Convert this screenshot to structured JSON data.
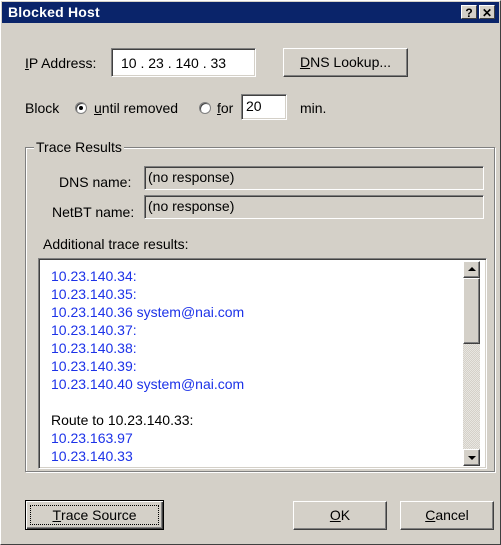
{
  "window": {
    "title": "Blocked Host",
    "help_button": "?",
    "close_button": "✕"
  },
  "ip": {
    "label_mnemonic": "I",
    "label_rest": "P Address:",
    "value": "10 . 23 . 140 . 33"
  },
  "dns_lookup": {
    "mnemonic": "D",
    "rest": "NS Lookup..."
  },
  "block": {
    "label": "Block",
    "until_removed_mnemonic": "u",
    "until_removed_rest": "ntil removed",
    "until_removed_checked": true,
    "for_mnemonic": "f",
    "for_rest": "or",
    "for_checked": false,
    "minutes_value": "20",
    "minutes_unit": "min."
  },
  "trace": {
    "group_title": "Trace Results",
    "dns_name_label": "DNS name:",
    "dns_name_value": "(no response)",
    "netbt_name_label": "NetBT name:",
    "netbt_name_value": "(no response)",
    "additional_label": "Additional trace results:",
    "lines": [
      {
        "text": "10.23.140.34:",
        "blue": true
      },
      {
        "text": "10.23.140.35:",
        "blue": true
      },
      {
        "text": "10.23.140.36 system@nai.com",
        "blue": true
      },
      {
        "text": "10.23.140.37:",
        "blue": true
      },
      {
        "text": "10.23.140.38:",
        "blue": true
      },
      {
        "text": "10.23.140.39:",
        "blue": true
      },
      {
        "text": "10.23.140.40 system@nai.com",
        "blue": true
      },
      {
        "text": "",
        "blue": false
      },
      {
        "text": "Route to 10.23.140.33:",
        "blue": false
      },
      {
        "text": "10.23.163.97",
        "blue": true
      },
      {
        "text": "10.23.140.33",
        "blue": true
      }
    ]
  },
  "buttons": {
    "trace_source_mnemonic": "T",
    "trace_source_rest": "race Source",
    "ok_mnemonic": "O",
    "ok_rest": "K",
    "cancel_mnemonic": "C",
    "cancel_rest": "ancel"
  },
  "colors": {
    "face": "#d4d0c8",
    "titlebar": "#0a246a",
    "link_blue": "#1c32e8"
  }
}
